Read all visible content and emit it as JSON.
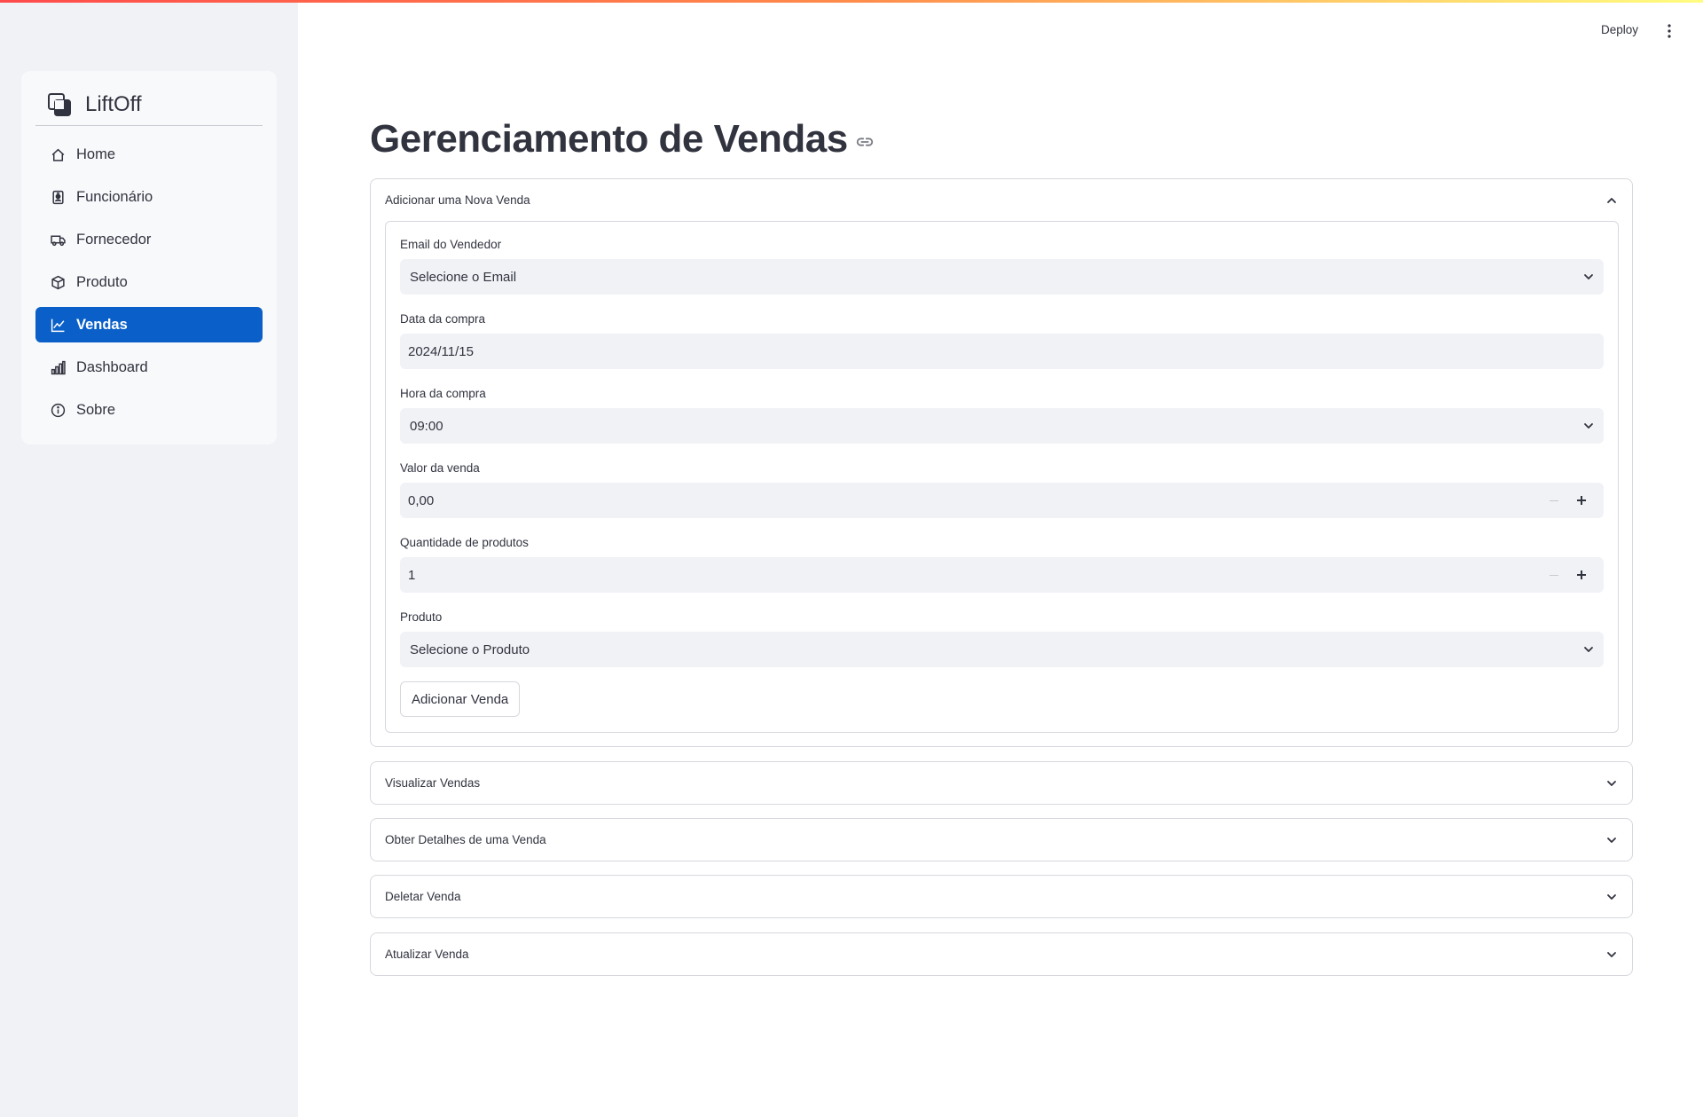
{
  "sidebar": {
    "brand": "LiftOff",
    "items": [
      {
        "label": "Home",
        "icon": "house-icon"
      },
      {
        "label": "Funcionário",
        "icon": "person-badge-icon"
      },
      {
        "label": "Fornecedor",
        "icon": "truck-icon"
      },
      {
        "label": "Produto",
        "icon": "box-icon"
      },
      {
        "label": "Vendas",
        "icon": "graph-up-icon",
        "active": true
      },
      {
        "label": "Dashboard",
        "icon": "bar-chart-icon"
      },
      {
        "label": "Sobre",
        "icon": "info-circle-icon"
      }
    ]
  },
  "header": {
    "deploy_label": "Deploy"
  },
  "page": {
    "title": "Gerenciamento de Vendas"
  },
  "add_sale": {
    "header": "Adicionar uma Nova Venda",
    "email_label": "Email do Vendedor",
    "email_value": "Selecione o Email",
    "date_label": "Data da compra",
    "date_value": "2024/11/15",
    "time_label": "Hora da compra",
    "time_value": "09:00",
    "value_label": "Valor da venda",
    "value_value": "0,00",
    "quantity_label": "Quantidade de produtos",
    "quantity_value": "1",
    "product_label": "Produto",
    "product_value": "Selecione o Produto",
    "submit_label": "Adicionar Venda"
  },
  "expanders": {
    "view": "Visualizar Vendas",
    "details": "Obter Detalhes de uma Venda",
    "delete": "Deletar Venda",
    "update": "Atualizar Venda"
  },
  "colors": {
    "accent": "#0a60c8",
    "sidebar_bg": "#f0f2f6",
    "input_bg": "#f0f2f6",
    "text": "#31333f"
  }
}
